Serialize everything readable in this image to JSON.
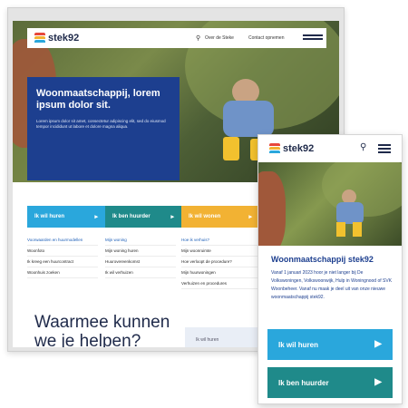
{
  "desktop": {
    "brand": "stek92",
    "nav": {
      "link1": "Over de Steke",
      "link2": "Contact opnemen"
    },
    "hero": {
      "title": "Woonmaatschappij, lorem ipsum dolor sit.",
      "body": "Lorem ipsum dolor sit amet, consectetur adipiscing elit, sed do eiusmod tempor incididunt ut labore et dolore magna aliqua."
    },
    "tabs": [
      {
        "label": "Ik wil huren",
        "color": "#2aa7dc"
      },
      {
        "label": "Ik ben huurder",
        "color": "#1f8a8a"
      },
      {
        "label": "Ik wil wonen",
        "color": "#f2b233"
      }
    ],
    "columns": [
      [
        "Voorwaarden en huurmodellen",
        "Woonfoto",
        "Ik kreeg een huurcontract",
        "Woonhuis zoeken"
      ],
      [
        "Mijn woning",
        "Mijn woning huren",
        "Huurovereenkomst",
        "Ik wil verhuizen"
      ],
      [
        "Hoe ik verhuis?",
        "Mijn woonruimte",
        "Hoe verloopt de procedure?",
        "Mijn huurwoningen",
        "Verhuizen en procedures"
      ]
    ],
    "question": "Waarmee kunnen we je helpen?",
    "search_placeholder": "Ik wil huren"
  },
  "mobile": {
    "brand": "stek92",
    "title": "Woonmaatschappij stek92",
    "body": "Vanaf 1 januari 2023 hoor je niet langer bij De Volkswoningen, Volkswoonwijk, Hulp in Woningnood of SVK Woonbeheer. Vanaf nu maak je deel uit van onze nieuwe woonmaatschappij stek92.",
    "buttons": [
      {
        "label": "Ik wil huren",
        "color": "#2aa7dc"
      },
      {
        "label": "Ik ben huurder",
        "color": "#1f8a8a"
      }
    ]
  },
  "colors": {
    "navy": "#1d3f8f",
    "blue": "#2aa7dc",
    "teal": "#1f8a8a",
    "yellow": "#f2b233"
  },
  "icons": [
    "search-icon",
    "hamburger-menu-icon",
    "chevron-right-icon",
    "logo-mark-icon"
  ]
}
